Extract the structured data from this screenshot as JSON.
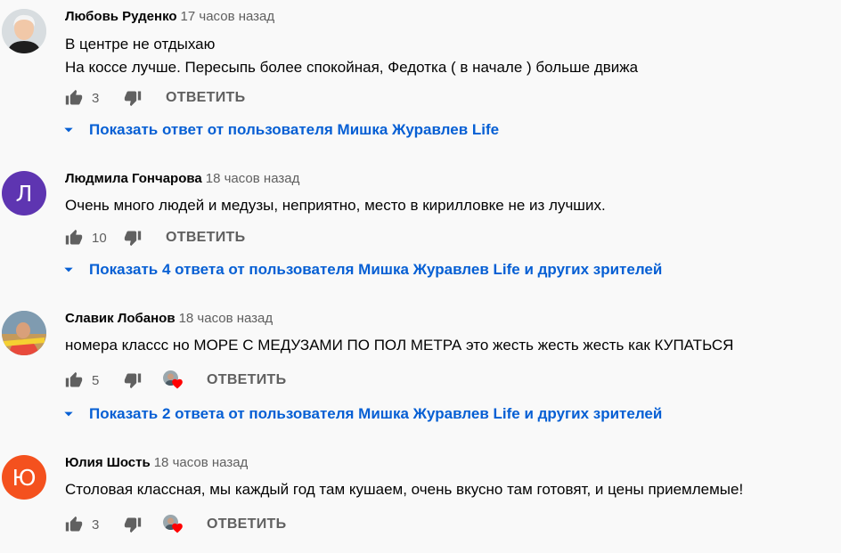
{
  "comments": [
    {
      "author": "Любовь Руденко",
      "time": "17 часов назад",
      "lines": [
        "В центре не отдыхаю",
        "На коссе лучше. Пересыпь более спокойная, Федотка ( в начале ) больше движа"
      ],
      "likes": "3",
      "reply_label": "ОТВЕТИТЬ",
      "replies_label": "Показать ответ от пользователя Мишка Журавлев Life",
      "avatar_type": "photo"
    },
    {
      "author": "Людмила Гончарова",
      "time": "18 часов назад",
      "lines": [
        "Очень много людей и медузы, неприятно, место в кирилловке не из лучших."
      ],
      "likes": "10",
      "reply_label": "ОТВЕТИТЬ",
      "replies_label": "Показать 4 ответа от пользователя Мишка Журавлев Life и других зрителей",
      "avatar_letter": "Л",
      "avatar_color": "#5e35b1"
    },
    {
      "author": "Славик Лобанов",
      "time": "18 часов назад",
      "lines": [
        "номера классс но МОРЕ С МЕДУЗАМИ ПО ПОЛ МЕТРА это жесть жесть жесть как КУПАТЬСЯ"
      ],
      "likes": "5",
      "reply_label": "ОТВЕТИТЬ",
      "replies_label": "Показать 2 ответа от пользователя Мишка Журавлев Life и других зрителей",
      "avatar_type": "photo",
      "creator_heart": true
    },
    {
      "author": "Юлия Шость",
      "time": "18 часов назад",
      "lines": [
        "Столовая классная, мы каждый год там кушаем, очень вкусно там готовят, и цены приемлемые!"
      ],
      "likes": "3",
      "reply_label": "ОТВЕТИТЬ",
      "avatar_letter": "Ю",
      "avatar_color": "#f4511e",
      "creator_heart": true
    }
  ],
  "colors": {
    "link": "#065fd4",
    "secondary": "#606060",
    "heart": "#ff0000"
  }
}
